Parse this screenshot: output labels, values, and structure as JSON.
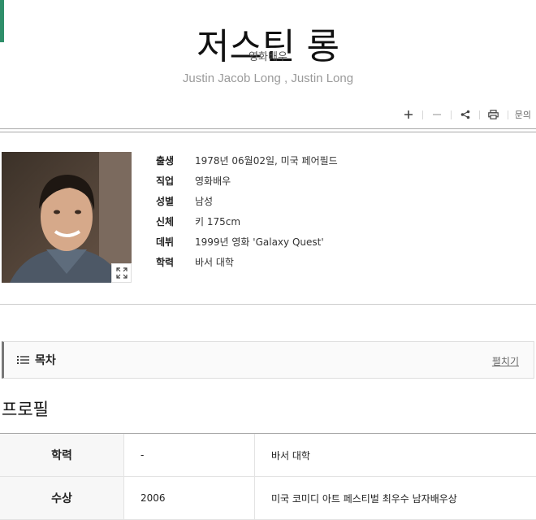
{
  "header": {
    "title": "저스틴 롱",
    "subtitle": "영화배우",
    "original_name": "Justin Jacob Long , Justin Long"
  },
  "toolbar": {
    "plus_icon": "plus-icon",
    "minus_icon": "minus-icon",
    "share_icon": "share-icon",
    "print_icon": "print-icon",
    "inquiry_label": "문의"
  },
  "profile_card": {
    "photo_icon": "portrait-photo",
    "expand_icon": "expand-icon",
    "rows": [
      {
        "key": "출생",
        "value": "1978년 06월02일, 미국 페어필드"
      },
      {
        "key": "직업",
        "value": "영화배우"
      },
      {
        "key": "성별",
        "value": "남성"
      },
      {
        "key": "신체",
        "value": "키 175cm"
      },
      {
        "key": "데뷔",
        "value": "1999년 영화 'Galaxy Quest'"
      },
      {
        "key": "학력",
        "value": "바서 대학"
      }
    ]
  },
  "toc": {
    "label": "목차",
    "toggle_label": "펼치기"
  },
  "profile_section": {
    "title": "프로필",
    "rows": [
      {
        "head": "학력",
        "col2": "-",
        "col3": "바서 대학"
      },
      {
        "head": "수상",
        "col2": "2006",
        "col3": "미국 코미디 아트 페스티벌 최우수 남자배우상"
      }
    ]
  },
  "colors": {
    "accent": "#2f8f6a",
    "original_name": "#9a9a9a"
  }
}
